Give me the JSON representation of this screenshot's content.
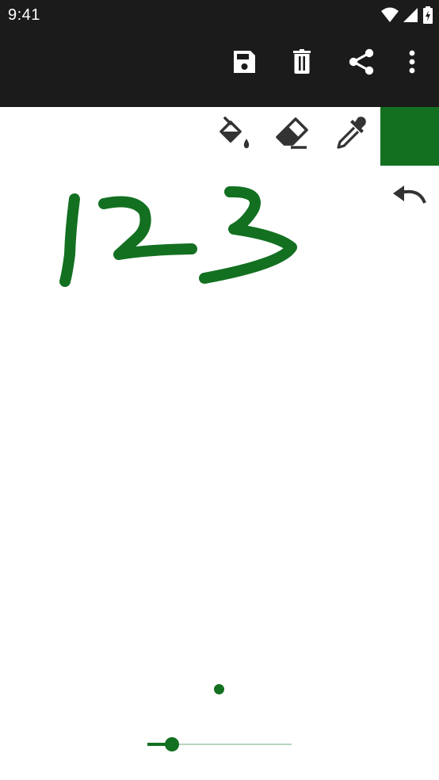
{
  "status_bar": {
    "time": "9:41"
  },
  "toolbar": {
    "actions": [
      {
        "name": "save",
        "icon": "save-icon"
      },
      {
        "name": "delete",
        "icon": "trash-icon"
      },
      {
        "name": "share",
        "icon": "share-icon"
      },
      {
        "name": "more",
        "icon": "more-vert-icon"
      }
    ]
  },
  "tools": [
    {
      "name": "fill",
      "icon": "paint-bucket-icon"
    },
    {
      "name": "eraser",
      "icon": "eraser-icon"
    },
    {
      "name": "color-picker",
      "icon": "eyedropper-icon"
    }
  ],
  "colors": {
    "bar_bg": "#1b1b1b",
    "accent": "#137021",
    "selected_color": "#137021",
    "icon_dark": "#333333"
  },
  "canvas": {
    "undo_icon": "undo-icon",
    "drawing_text": "123"
  },
  "brush": {
    "size_level": 0.17
  }
}
